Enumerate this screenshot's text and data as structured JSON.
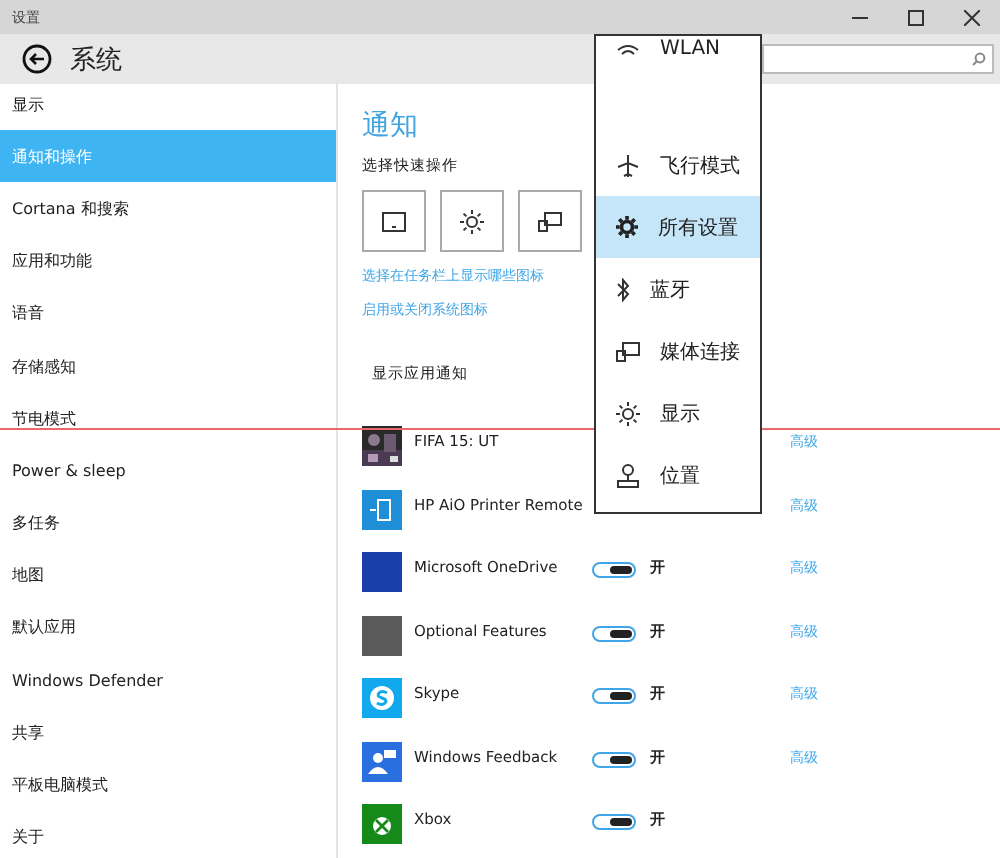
{
  "window": {
    "title": "设置",
    "header": "系统"
  },
  "sidebar": {
    "items": [
      {
        "label": "显示",
        "selected": false
      },
      {
        "label": "通知和操作",
        "selected": true
      },
      {
        "label": "Cortana 和搜索",
        "selected": false
      },
      {
        "label": "应用和功能",
        "selected": false
      },
      {
        "label": "语音",
        "selected": false
      },
      {
        "label": "存储感知",
        "selected": false
      },
      {
        "label": "节电模式",
        "selected": false
      },
      {
        "label": "Power & sleep",
        "selected": false
      },
      {
        "label": "多任务",
        "selected": false
      },
      {
        "label": "地图",
        "selected": false
      },
      {
        "label": "默认应用",
        "selected": false
      },
      {
        "label": "Windows Defender",
        "selected": false
      },
      {
        "label": "共享",
        "selected": false
      },
      {
        "label": "平板电脑模式",
        "selected": false
      },
      {
        "label": "关于",
        "selected": false
      }
    ]
  },
  "content": {
    "title": "通知",
    "quick_actions_label": "选择快速操作",
    "quick_actions": [
      {
        "kind": "tablet"
      },
      {
        "kind": "brightness"
      },
      {
        "kind": "project"
      }
    ],
    "links": [
      "选择在任务栏上显示哪些图标",
      "启用或关闭系统图标"
    ],
    "apps_label": "显示应用通知",
    "apps": [
      {
        "name": "FIFA 15: UT",
        "color": "#2a2a2a",
        "kind": "picture",
        "advanced": "高级"
      },
      {
        "name": "HP AiO Printer Remote",
        "color": "#1e8fd6",
        "kind": "printer",
        "advanced": "高级"
      },
      {
        "name": "Microsoft OneDrive",
        "color": "#1b3faa",
        "kind": "plain",
        "toggle": {
          "on": true,
          "label": "开"
        },
        "advanced": "高级"
      },
      {
        "name": "Optional Features",
        "color": "#5a5a5a",
        "kind": "plain",
        "toggle": {
          "on": true,
          "label": "开"
        },
        "advanced": "高级"
      },
      {
        "name": "Skype",
        "color": "#12a8ee",
        "kind": "skype",
        "toggle": {
          "on": true,
          "label": "开"
        },
        "advanced": "高级"
      },
      {
        "name": "Windows Feedback",
        "color": "#2a6fe0",
        "kind": "feedback",
        "toggle": {
          "on": true,
          "label": "开"
        },
        "advanced": "高级"
      },
      {
        "name": "Xbox",
        "color": "#168a18",
        "kind": "xbox",
        "toggle": {
          "on": true,
          "label": "开"
        }
      }
    ]
  },
  "popup": {
    "items": [
      {
        "label": "WLAN",
        "kind": "wifi",
        "selected": false
      },
      {
        "label": "飞行模式",
        "kind": "airplane",
        "selected": false
      },
      {
        "label": "所有设置",
        "kind": "gear",
        "selected": true
      },
      {
        "label": "蓝牙",
        "kind": "bluetooth",
        "selected": false
      },
      {
        "label": "媒体连接",
        "kind": "project",
        "selected": false
      },
      {
        "label": "显示",
        "kind": "brightness",
        "selected": false
      },
      {
        "label": "位置",
        "kind": "location",
        "selected": false
      }
    ]
  }
}
